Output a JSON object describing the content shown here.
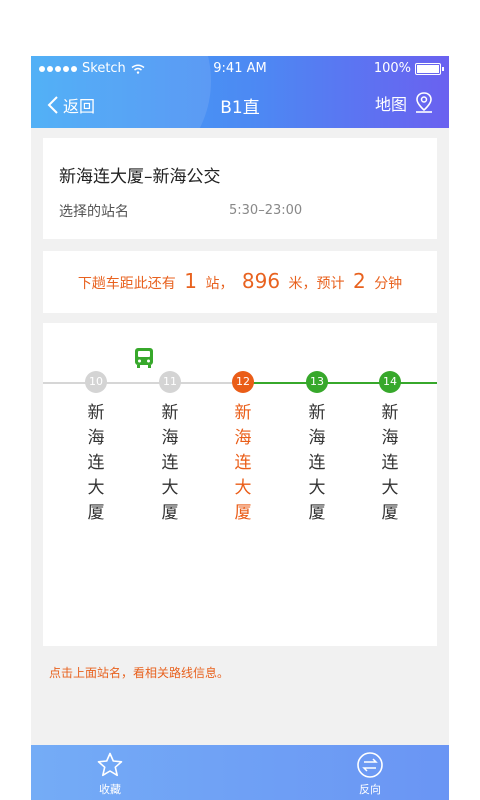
{
  "status": {
    "carrier": "Sketch",
    "time": "9:41 AM",
    "battery": "100%"
  },
  "nav": {
    "back_label": "返回",
    "title": "B1直",
    "map_label": "地图"
  },
  "route": {
    "name": "新海连大厦–新海公交",
    "station_label": "选择的站名",
    "hours": "5:30–23:00"
  },
  "arrival": {
    "prefix": "下趟车距此还有",
    "stations": "1",
    "stations_unit": "站，",
    "distance": "896",
    "distance_unit": "米，预计",
    "minutes": "2",
    "minutes_unit": "分钟"
  },
  "stops": [
    {
      "num": "10",
      "name": "新海连大厦",
      "state": "passed"
    },
    {
      "num": "11",
      "name": "新海连大厦",
      "state": "passed"
    },
    {
      "num": "12",
      "name": "新海连大厦",
      "state": "selected"
    },
    {
      "num": "13",
      "name": "新海连大厦",
      "state": "upcoming"
    },
    {
      "num": "14",
      "name": "新海连大厦",
      "state": "upcoming"
    }
  ],
  "hint": "点击上面站名，看相关路线信息。",
  "tabs": {
    "favorite_label": "收藏",
    "reverse_label": "反向"
  },
  "colors": {
    "accent": "#e8621f",
    "route_green": "#37a82b",
    "header_start": "#3fa8f5",
    "header_end": "#6a61f0"
  }
}
